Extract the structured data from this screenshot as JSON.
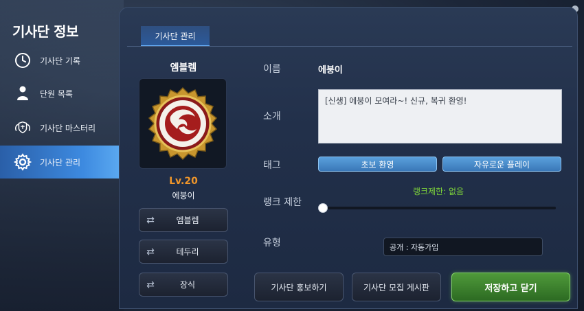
{
  "window": {
    "title": "기사단 정보"
  },
  "sidebar": {
    "items": [
      {
        "label": "기사단 기록",
        "icon": "clock-icon"
      },
      {
        "label": "단원 목록",
        "icon": "person-icon"
      },
      {
        "label": "기사단 마스터리",
        "icon": "shield-wings-icon"
      },
      {
        "label": "기사단 관리",
        "icon": "gear-icon",
        "active": true
      }
    ]
  },
  "tab": {
    "label": "기사단 관리"
  },
  "emblem": {
    "title": "엠블렘",
    "level": "Lv.20",
    "guild_name": "에붕이",
    "buttons": [
      {
        "label": "엠블렘",
        "icon": "refresh-icon"
      },
      {
        "label": "테두리",
        "icon": "refresh-icon"
      },
      {
        "label": "장식",
        "icon": "refresh-icon"
      }
    ]
  },
  "form": {
    "name_label": "이름",
    "name_value": "에붕이",
    "intro_label": "소개",
    "intro_value": "[신생] 에붕이 모여라~! 신규, 복귀 환영!",
    "tag_label": "태그",
    "tags": [
      "초보 환영",
      "자유로운 플레이"
    ],
    "rank_label": "랭크 제한",
    "rank_text": "랭크제한: 없음",
    "rank_slider_value": 0,
    "type_label": "유형",
    "type_value": "공개 : 자동가입"
  },
  "footer": {
    "promote_label": "기사단 홍보하기",
    "board_label": "기사단 모집 게시판",
    "save_label": "저장하고 닫기"
  },
  "colors": {
    "accent_blue": "#3d8ae0",
    "level_orange": "#f0962a",
    "rank_green": "#7dd33a",
    "save_green": "#4f9a3a"
  }
}
